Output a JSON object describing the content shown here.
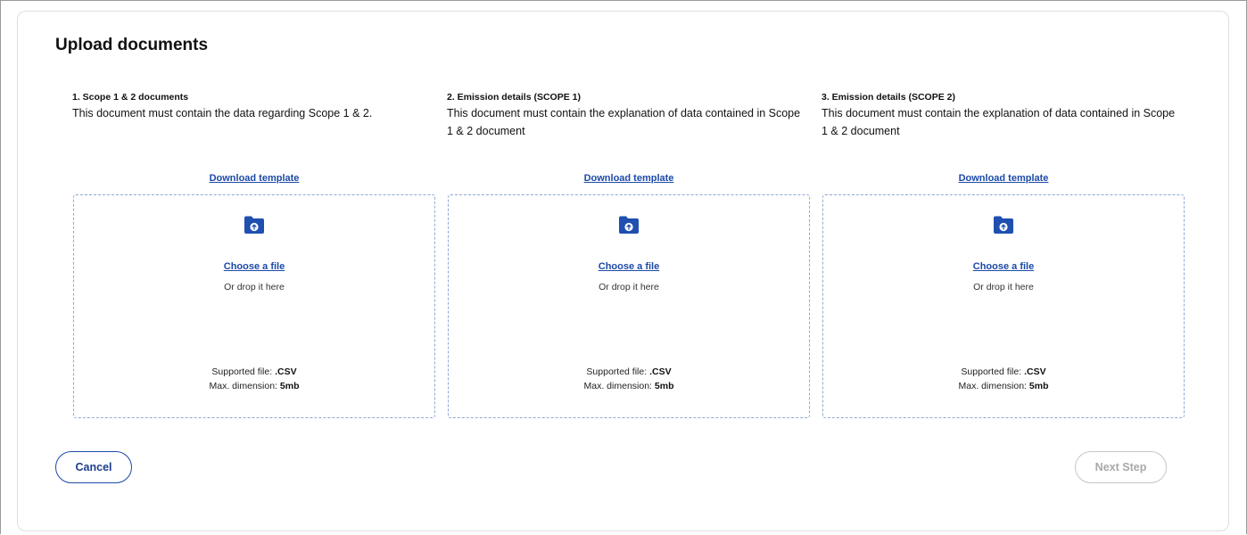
{
  "page": {
    "title": "Upload documents"
  },
  "colors": {
    "accent": "#1c4aa8",
    "icon_fill": "#1f4fb0",
    "dropzone_border": "#8ea8d6",
    "disabled_text": "#a9a9a9"
  },
  "columns": [
    {
      "heading": "1. Scope 1 & 2 documents",
      "description": "This document must contain the data regarding Scope 1 & 2.",
      "download_label": "Download template",
      "choose_label": "Choose a file",
      "drop_hint": "Or drop it here",
      "supported_label": "Supported file: ",
      "supported_value": ".CSV",
      "max_label": "Max. dimension: ",
      "max_value": "5mb",
      "icon": "folder-upload-icon"
    },
    {
      "heading": "2. Emission details (SCOPE 1)",
      "description": "This document must contain the explanation of data contained in Scope 1 & 2 document",
      "download_label": "Download template",
      "choose_label": "Choose a file",
      "drop_hint": "Or drop it here",
      "supported_label": "Supported file: ",
      "supported_value": ".CSV",
      "max_label": "Max. dimension: ",
      "max_value": "5mb",
      "icon": "folder-upload-icon"
    },
    {
      "heading": "3. Emission details (SCOPE 2)",
      "description": "This document must contain the explanation of data contained in Scope 1 & 2 document",
      "download_label": "Download template",
      "choose_label": "Choose a file",
      "drop_hint": "Or drop it here",
      "supported_label": "Supported file: ",
      "supported_value": ".CSV",
      "max_label": "Max. dimension: ",
      "max_value": "5mb",
      "icon": "folder-upload-icon"
    }
  ],
  "footer": {
    "cancel_label": "Cancel",
    "next_label": "Next Step",
    "next_disabled": true
  }
}
